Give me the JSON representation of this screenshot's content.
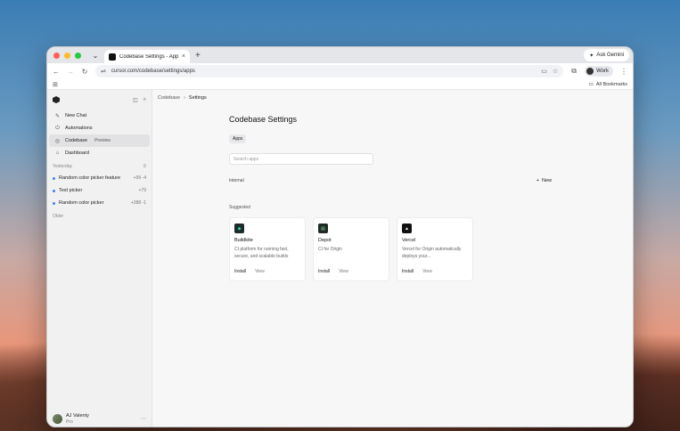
{
  "browser": {
    "tab_title": "Codebase Settings - Apps | C...",
    "ask_gemini": "Ask Gemini",
    "url": "cursor.com/codebase/settings/apps",
    "profile": "Work",
    "all_bookmarks": "All Bookmarks"
  },
  "sidebar": {
    "items": [
      {
        "label": "New Chat",
        "icon": "compose-icon"
      },
      {
        "label": "Automations",
        "icon": "automation-icon"
      },
      {
        "label": "Codebase",
        "icon": "codebase-icon",
        "badge": "Preview"
      },
      {
        "label": "Dashboard",
        "icon": "home-icon"
      }
    ],
    "section_yesterday": "Yesterday",
    "chats": [
      {
        "label": "Random color picker feature",
        "stat": "+99 -4"
      },
      {
        "label": "Test picker",
        "stat": "+79"
      },
      {
        "label": "Random color picker",
        "stat": "+388 -1"
      }
    ],
    "section_older": "Older",
    "user": {
      "name": "AJ Valenty",
      "plan": "Pro"
    }
  },
  "breadcrumb": {
    "root": "Codebase",
    "current": "Settings"
  },
  "main": {
    "title": "Codebase Settings",
    "tab": "Apps",
    "search_placeholder": "Search apps",
    "internal_label": "Internal",
    "new_label": "New",
    "suggested_label": "Suggested",
    "cards": [
      {
        "name": "Buildkite",
        "desc": "CI platform for running fast, secure, and scalable builds",
        "install": "Install",
        "view": "View"
      },
      {
        "name": "Depot",
        "desc": "CI for Origin",
        "install": "Install",
        "view": "View"
      },
      {
        "name": "Vercel",
        "desc": "Vercel for Origin automatically deploys your...",
        "install": "Install",
        "view": "View"
      }
    ]
  },
  "colors": {
    "accent": "#3b82f6",
    "close": "#ff5f57",
    "minimize": "#febc2e",
    "maximize": "#28c840"
  }
}
